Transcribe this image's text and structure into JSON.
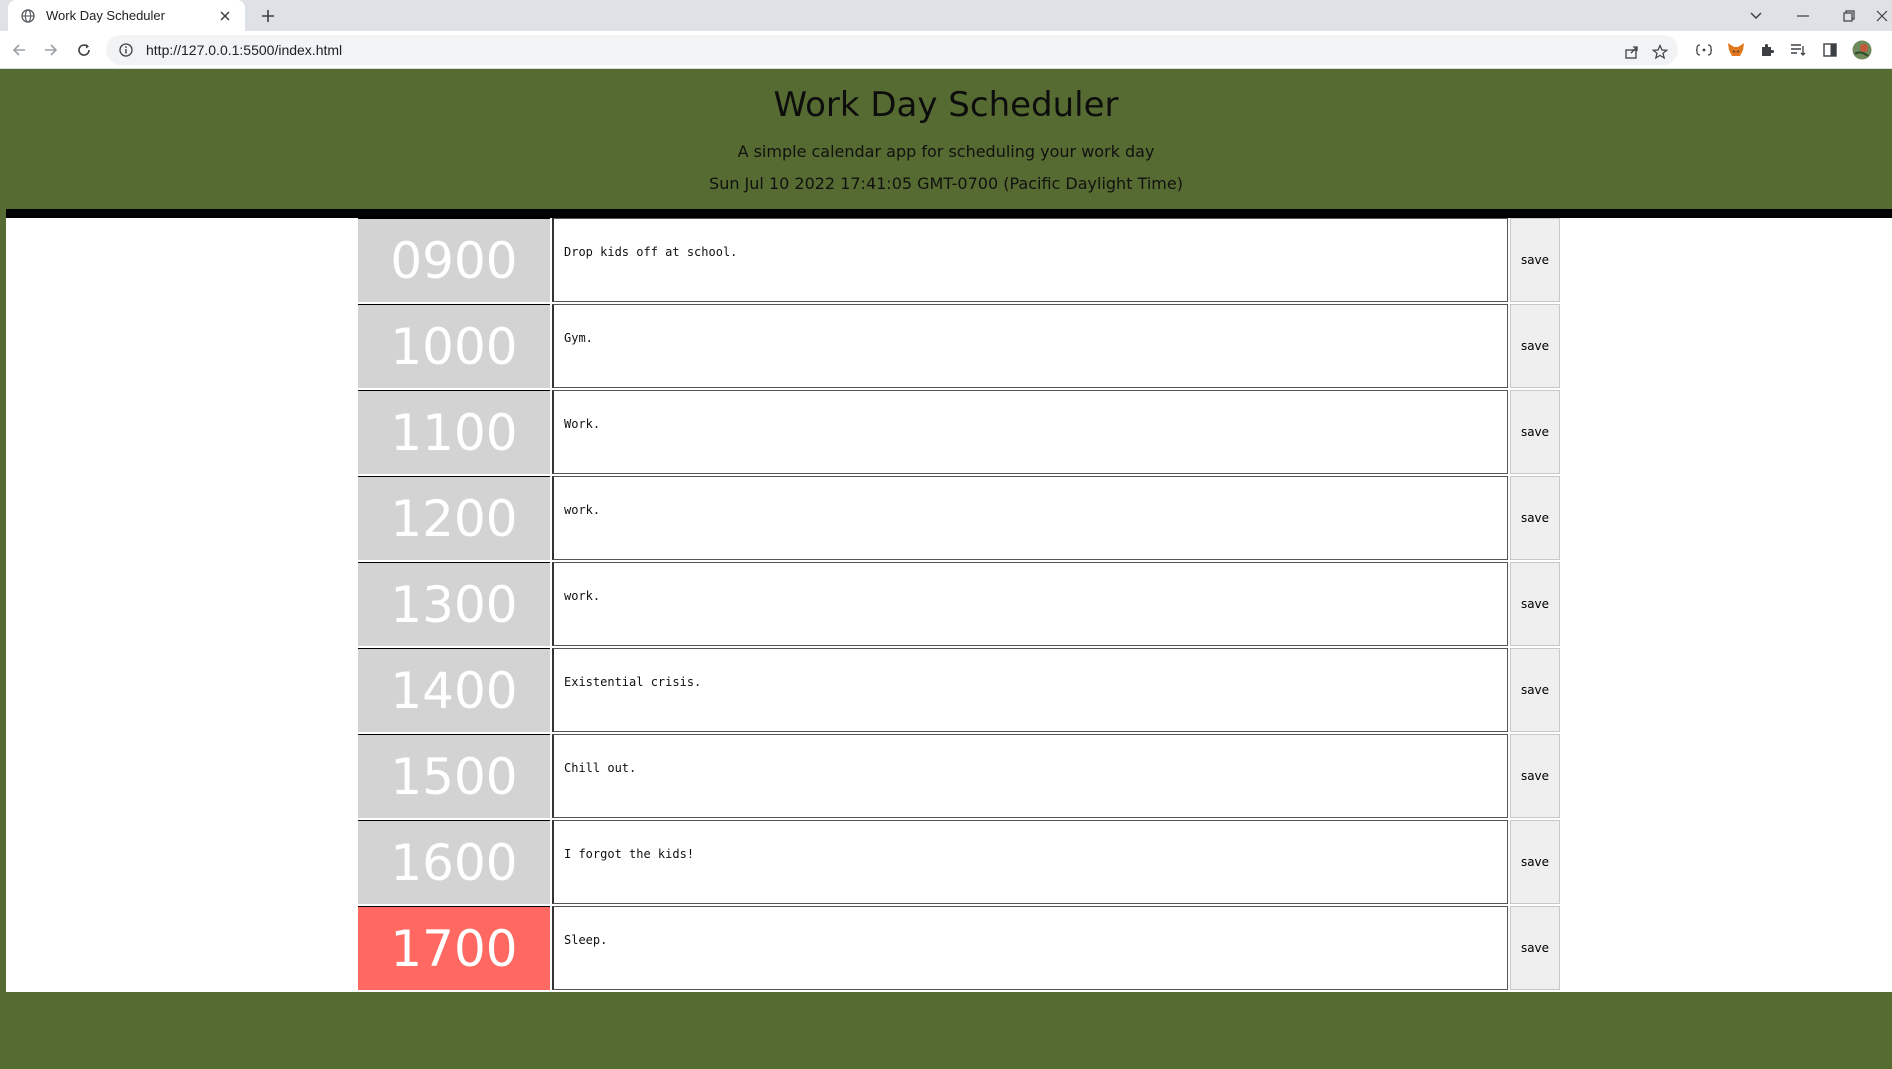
{
  "browser": {
    "tab_title": "Work Day Scheduler",
    "url": "http://127.0.0.1:5500/index.html"
  },
  "header": {
    "title": "Work Day Scheduler",
    "subtitle": "A simple calendar app for scheduling your work day",
    "current_day": "Sun Jul 10 2022 17:41:05 GMT-0700 (Pacific Daylight Time)"
  },
  "colors": {
    "background": "#566b31",
    "past": "#d3d3d3",
    "present": "#ff6961"
  },
  "time_blocks": [
    {
      "hour": "0900",
      "text": "Drop kids off at school.",
      "state": "past",
      "save_label": "save"
    },
    {
      "hour": "1000",
      "text": "Gym.",
      "state": "past",
      "save_label": "save"
    },
    {
      "hour": "1100",
      "text": "Work.",
      "state": "past",
      "save_label": "save"
    },
    {
      "hour": "1200",
      "text": "work.",
      "state": "past",
      "save_label": "save"
    },
    {
      "hour": "1300",
      "text": "work.",
      "state": "past",
      "save_label": "save"
    },
    {
      "hour": "1400",
      "text": "Existential crisis.",
      "state": "past",
      "save_label": "save"
    },
    {
      "hour": "1500",
      "text": "Chill out.",
      "state": "past",
      "save_label": "save"
    },
    {
      "hour": "1600",
      "text": "I forgot the kids!",
      "state": "past",
      "save_label": "save"
    },
    {
      "hour": "1700",
      "text": "Sleep.",
      "state": "present",
      "save_label": "save"
    }
  ]
}
